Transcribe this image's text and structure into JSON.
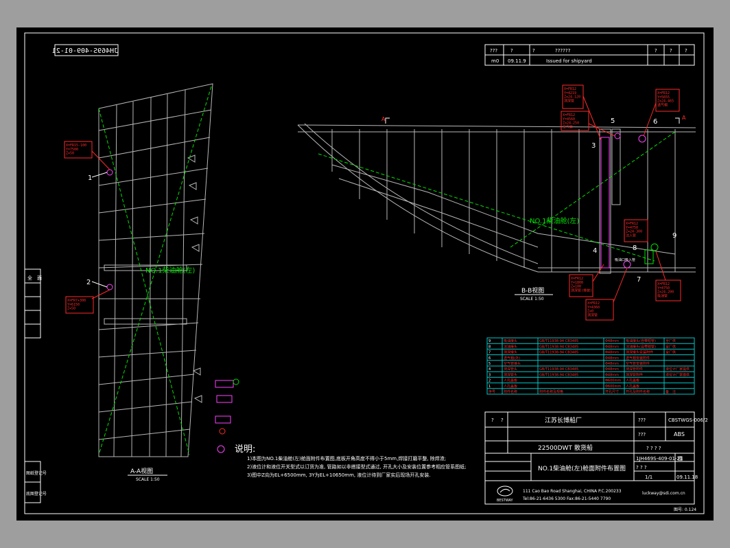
{
  "drawing": {
    "mirrored_number": "JH469S-409-01-21",
    "sheet_annotation": "图号: 0.124",
    "revision_table": {
      "header": [
        "???",
        "?",
        "?",
        "??????",
        "?",
        "?",
        "?"
      ],
      "row": [
        "m0",
        "09.11.9",
        "Issued for shipyard"
      ]
    },
    "side_labels": {
      "top": "全　面",
      "mid": "图纸登记号",
      "bottom": "底图登记号"
    },
    "view_aa": {
      "title": "A-A视图",
      "scale": "SCALE 1:50"
    },
    "view_bb": {
      "title": "B-B视图",
      "scale": "SCALE 1:50"
    },
    "tank_label": "NO.1柴油舱(左)",
    "section_marker": "A",
    "callouts": [
      {
        "id": "1",
        "text": "X=FR15-100\nY=7500\nZ=50"
      },
      {
        "id": "2",
        "text": "X=FR7+300\nY=6150\nZ=50"
      },
      {
        "id": "3",
        "text": "X=FR12\nY=4219\nZ=24-120\n测深管"
      },
      {
        "id": "4",
        "text": "X=FR12\nY=1800\nZ=100\n测深管(排放)"
      },
      {
        "id": "5",
        "text": "X=FR12\nY=4560\nZ=24-250\n空气管"
      },
      {
        "id": "6",
        "text": "X=FR12\nY=5655\nZ=24-465\n透气帽"
      },
      {
        "id": "7",
        "text": "X=FR12\nY=4360\nZ=0\n测深管"
      },
      {
        "id": "8",
        "text": "X=FR12\nY=4750\nZ=24-300\n注入管"
      },
      {
        "id": "9",
        "text": "X=FR12\nY=4750\nZ=24-200\n吸油管"
      }
    ],
    "small_label": "吸油口吸入管"
  },
  "notes": {
    "heading": "说明:",
    "lines": [
      "1)本图为NO.1柴油舱(左)舱面附件布置图,底板开角高度不得小于5mm,焊接打磨平整, 除焊渣;",
      "2)液位计和液位开关型式以订货为准, 管路如以非搭接型式通过, 开孔大小及安装位置参考相应管系图纸;",
      "3)图中Z向为EL+6500mm, 3Y为EL+10650mm, 液位计待到厂家实后现场开孔安装."
    ]
  },
  "parts_table": {
    "rows": [
      [
        "9",
        "吸油接头",
        "GB/T11938-94 CB3485",
        "Φ48mm",
        "吸油接头(自带短管)",
        "全厂供"
      ],
      [
        "8",
        "注油接头",
        "GB/T11938-94 CB3485",
        "Φ48mm",
        "注油接头(自带短管)",
        "全厂供"
      ],
      [
        "7",
        "测深接头",
        "GB/T11938-94 CB3485",
        "Φ48mm",
        "测深接头安装附件",
        "全厂供"
      ],
      [
        "6",
        "透气帽(外)",
        "",
        "Φ48mm",
        "透气帽安装附件",
        ""
      ],
      [
        "5",
        "空气管接头",
        "",
        "Φ48mm",
        "空气管安装附件",
        ""
      ],
      [
        "4",
        "测深管头",
        "GB/T11938-94 CB3485",
        "Φ48mm",
        "测深管附件",
        "液位计厂家提供"
      ],
      [
        "3",
        "测深管头",
        "GB/T11938-94 CB3485",
        "Φ48mm",
        "测深管附件",
        "液位计厂家提供"
      ],
      [
        "2",
        "人孔盖板",
        "",
        "Φ600mm",
        "人孔盖板",
        ""
      ],
      [
        "1",
        "人孔盖板",
        "",
        "Φ600mm",
        "人孔盖板",
        ""
      ]
    ],
    "header": [
      "序号",
      "附件名称",
      "附件名称及规格",
      "开孔尺寸",
      "开孔及附件名称",
      "备　注"
    ]
  },
  "title_block": {
    "company": "江苏长博船厂",
    "drawing_code": "CBSTWGS-006/2",
    "class_society": "ABS",
    "vessel": "22500DWT 散货船",
    "title": "NO.1柴油舱(左)舱面附件布置图",
    "drawing_no": "1JH469S-409-01-21",
    "sheet": "1/1",
    "date": "09.11.18",
    "placeholders": [
      "?",
      "?",
      "???",
      "???",
      "? ? ? ?",
      "? ? ?"
    ],
    "sheet_word": "图",
    "address": "111 Cao Bao Road Shanghai, CHINA P.C.200233",
    "phone": "Tel:86-21-6436 5300 Fax:86-21-5440 7790",
    "email": "luckway@sdi.com.cn",
    "logo_text": "BESTWAY"
  },
  "colors": {
    "background": "#000000",
    "frame": "#ffffff",
    "structure": "#b8b8b8",
    "callout": "#ff2a2a",
    "diagonal": "#00e000",
    "table_grid": "#00c8c8",
    "part": "#ff40ff"
  }
}
